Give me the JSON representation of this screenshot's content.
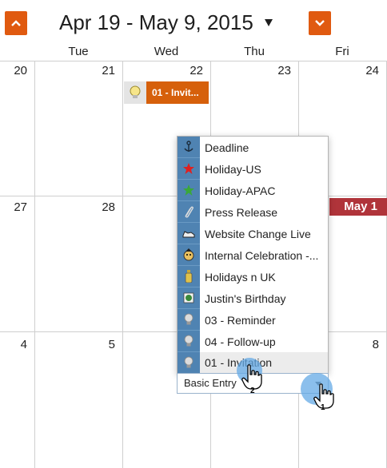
{
  "header": {
    "range_title": "Apr 19 - May 9, 2015"
  },
  "days": [
    "Tue",
    "Wed",
    "Thu",
    "Fri"
  ],
  "dates": {
    "row1": [
      "20",
      "21",
      "22",
      "23",
      "24"
    ],
    "row2": [
      "27",
      "28"
    ],
    "row3": [
      "4",
      "5",
      "8"
    ]
  },
  "event": {
    "label": "01 - Invit..."
  },
  "may_banner": "May 1",
  "menu": {
    "items": [
      {
        "label": "Deadline",
        "icon": "anchor-icon"
      },
      {
        "label": "Holiday-US",
        "icon": "red-star-icon"
      },
      {
        "label": "Holiday-APAC",
        "icon": "green-star-icon"
      },
      {
        "label": "Press Release",
        "icon": "paperclip-icon"
      },
      {
        "label": "Website Change Live",
        "icon": "sneaker-icon"
      },
      {
        "label": "Internal Celebration -...",
        "icon": "party-face-icon"
      },
      {
        "label": "Holidays n UK",
        "icon": "bottle-icon"
      },
      {
        "label": "Justin's Birthday",
        "icon": "globe-card-icon"
      },
      {
        "label": "03 - Reminder",
        "icon": "lightbulb-icon"
      },
      {
        "label": "04 - Follow-up",
        "icon": "lightbulb-icon"
      },
      {
        "label": "01 - Invitation",
        "icon": "lightbulb-icon"
      }
    ],
    "selected": "Basic Entry"
  },
  "steps": [
    "1",
    "2"
  ],
  "colors": {
    "accent": "#e05a10",
    "event": "#d6600b",
    "banner": "#b0343a",
    "menu_icon_bg": "#4f83b2"
  }
}
